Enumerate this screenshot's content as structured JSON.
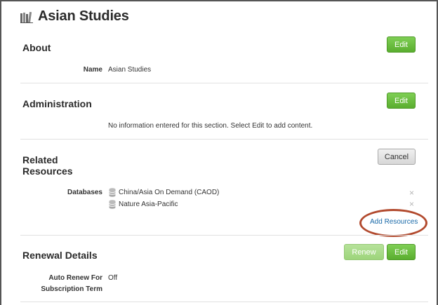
{
  "page": {
    "title": "Asian Studies"
  },
  "about": {
    "heading": "About",
    "edit_label": "Edit",
    "fields": [
      {
        "label": "Name",
        "value": "Asian Studies"
      }
    ]
  },
  "administration": {
    "heading": "Administration",
    "edit_label": "Edit",
    "empty_message": "No information entered for this section. Select Edit to add content."
  },
  "related_resources": {
    "heading_line1": "Related",
    "heading_line2": "Resources",
    "cancel_label": "Cancel",
    "databases_label": "Databases",
    "databases": [
      {
        "name": "China/Asia On Demand (CAOD)",
        "remove": "×"
      },
      {
        "name": "Nature Asia-Pacific",
        "remove": "×"
      }
    ],
    "add_resources_label": "Add Resources"
  },
  "renewal": {
    "heading": "Renewal Details",
    "renew_label": "Renew",
    "edit_label": "Edit",
    "auto_renew_label_line1": "Auto Renew For",
    "auto_renew_label_line2": "Subscription Term",
    "auto_renew_value": "Off"
  },
  "colors": {
    "accent_green": "#5aae2f",
    "link_blue": "#1a6aa9",
    "highlight_ring": "#b24a2e"
  }
}
